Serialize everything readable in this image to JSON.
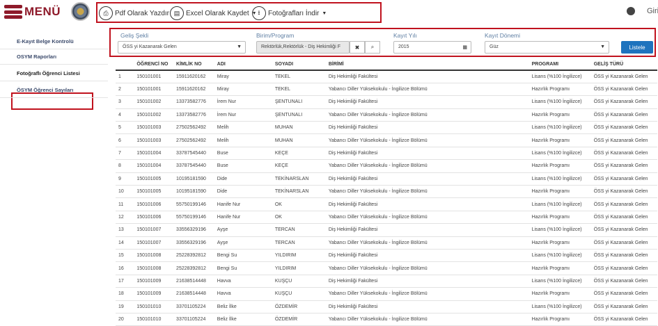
{
  "header": {
    "menu_label": "MENÜ",
    "toolbar": [
      {
        "label": "Pdf Olarak Yazdır",
        "icon": "print-icon",
        "glyph": "⎙",
        "caret": false
      },
      {
        "label": "Excel Olarak Kaydet",
        "icon": "excel-icon",
        "glyph": "▤",
        "caret": true
      },
      {
        "label": "Fotoğrafları İndir",
        "icon": "download-icon",
        "glyph": "⭳",
        "caret": true
      }
    ],
    "login_label": "Giri"
  },
  "sidebar": {
    "items": [
      {
        "label": "E-Kayıt Belge Kontrolü"
      },
      {
        "label": "OSYM Raporları"
      },
      {
        "label": "Fotoğraflı Öğrenci Listesi",
        "active": true
      },
      {
        "label": "ÖSYM Öğrenci Sayıları"
      }
    ]
  },
  "filters": {
    "gelis_sekli": {
      "label": "Geliş Şekli",
      "value": "ÖSS yi Kazanarak Gelen"
    },
    "birim": {
      "label": "Birim/Program",
      "value": "Rektörlük,Rektörlük - Diş Hekimliği F"
    },
    "kayit_yili": {
      "label": "Kayıt Yılı",
      "value": "2015"
    },
    "kayit_donemi": {
      "label": "Kayıt Dönemi",
      "value": "Güz"
    },
    "listele_label": "Listele"
  },
  "table": {
    "columns": [
      "",
      "ÖĞRENCİ NO",
      "KİMLİK NO",
      "ADI",
      "SOYADI",
      "BİRİMİ",
      "PROGRAMI",
      "GELİŞ TÜRÜ"
    ],
    "rows": [
      [
        "1",
        "150101001",
        "15911620162",
        "Miray",
        "TEKEL",
        "Diş Hekimliği Fakültesi",
        "Lisans (%100 İngilizce)",
        "ÖSS yi Kazanarak Gelen"
      ],
      [
        "2",
        "150101001",
        "15911620162",
        "Miray",
        "TEKEL",
        "Yabancı Diller Yüksekokulu - İngilizce Bölümü",
        "Hazırlık Programı",
        "ÖSS yi Kazanarak Gelen"
      ],
      [
        "3",
        "150101002",
        "13373582776",
        "İrem Nur",
        "ŞENTUNALI",
        "Diş Hekimliği Fakültesi",
        "Lisans (%100 İngilizce)",
        "ÖSS yi Kazanarak Gelen"
      ],
      [
        "4",
        "150101002",
        "13373582776",
        "İrem Nur",
        "ŞENTUNALI",
        "Yabancı Diller Yüksekokulu - İngilizce Bölümü",
        "Hazırlık Programı",
        "ÖSS yi Kazanarak Gelen"
      ],
      [
        "5",
        "150101003",
        "27502562492",
        "Melih",
        "MUHAN",
        "Diş Hekimliği Fakültesi",
        "Lisans (%100 İngilizce)",
        "ÖSS yi Kazanarak Gelen"
      ],
      [
        "6",
        "150101003",
        "27502562492",
        "Melih",
        "MUHAN",
        "Yabancı Diller Yüksekokulu - İngilizce Bölümü",
        "Hazırlık Programı",
        "ÖSS yi Kazanarak Gelen"
      ],
      [
        "7",
        "150101004",
        "33787545440",
        "Buse",
        "KEÇE",
        "Diş Hekimliği Fakültesi",
        "Lisans (%100 İngilizce)",
        "ÖSS yi Kazanarak Gelen"
      ],
      [
        "8",
        "150101004",
        "33787545440",
        "Buse",
        "KEÇE",
        "Yabancı Diller Yüksekokulu - İngilizce Bölümü",
        "Hazırlık Programı",
        "ÖSS yi Kazanarak Gelen"
      ],
      [
        "9",
        "150101005",
        "10195181590",
        "Dide",
        "TEKİNARSLAN",
        "Diş Hekimliği Fakültesi",
        "Lisans (%100 İngilizce)",
        "ÖSS yi Kazanarak Gelen"
      ],
      [
        "10",
        "150101005",
        "10195181590",
        "Dide",
        "TEKİNARSLAN",
        "Yabancı Diller Yüksekokulu - İngilizce Bölümü",
        "Hazırlık Programı",
        "ÖSS yi Kazanarak Gelen"
      ],
      [
        "11",
        "150101006",
        "55750199146",
        "Hanife Nur",
        "OK",
        "Diş Hekimliği Fakültesi",
        "Lisans (%100 İngilizce)",
        "ÖSS yi Kazanarak Gelen"
      ],
      [
        "12",
        "150101006",
        "55750199146",
        "Hanife Nur",
        "OK",
        "Yabancı Diller Yüksekokulu - İngilizce Bölümü",
        "Hazırlık Programı",
        "ÖSS yi Kazanarak Gelen"
      ],
      [
        "13",
        "150101007",
        "33556329196",
        "Ayşe",
        "TERCAN",
        "Diş Hekimliği Fakültesi",
        "Lisans (%100 İngilizce)",
        "ÖSS yi Kazanarak Gelen"
      ],
      [
        "14",
        "150101007",
        "33556329196",
        "Ayşe",
        "TERCAN",
        "Yabancı Diller Yüksekokulu - İngilizce Bölümü",
        "Hazırlık Programı",
        "ÖSS yi Kazanarak Gelen"
      ],
      [
        "15",
        "150101008",
        "25228392812",
        "Bengi Su",
        "YILDIRIM",
        "Diş Hekimliği Fakültesi",
        "Lisans (%100 İngilizce)",
        "ÖSS yi Kazanarak Gelen"
      ],
      [
        "16",
        "150101008",
        "25228392812",
        "Bengi Su",
        "YILDIRIM",
        "Yabancı Diller Yüksekokulu - İngilizce Bölümü",
        "Hazırlık Programı",
        "ÖSS yi Kazanarak Gelen"
      ],
      [
        "17",
        "150101009",
        "21638514448",
        "Havva",
        "KUŞÇU",
        "Diş Hekimliği Fakültesi",
        "Lisans (%100 İngilizce)",
        "ÖSS yi Kazanarak Gelen"
      ],
      [
        "18",
        "150101009",
        "21638514448",
        "Havva",
        "KUŞÇU",
        "Yabancı Diller Yüksekokulu - İngilizce Bölümü",
        "Hazırlık Programı",
        "ÖSS yi Kazanarak Gelen"
      ],
      [
        "19",
        "150101010",
        "33701105224",
        "Beliz İlke",
        "ÖZDEMİR",
        "Diş Hekimliği Fakültesi",
        "Lisans (%100 İngilizce)",
        "ÖSS yi Kazanarak Gelen"
      ],
      [
        "20",
        "150101010",
        "33701105224",
        "Beliz İlke",
        "ÖZDEMİR",
        "Yabancı Diller Yüksekokulu - İngilizce Bölümü",
        "Hazırlık Programı",
        "ÖSS yi Kazanarak Gelen"
      ]
    ]
  },
  "colors": {
    "brand": "#8e1a2a",
    "highlight": "#c0121e",
    "primary_button": "#1e73be",
    "label": "#5f7fa3"
  }
}
